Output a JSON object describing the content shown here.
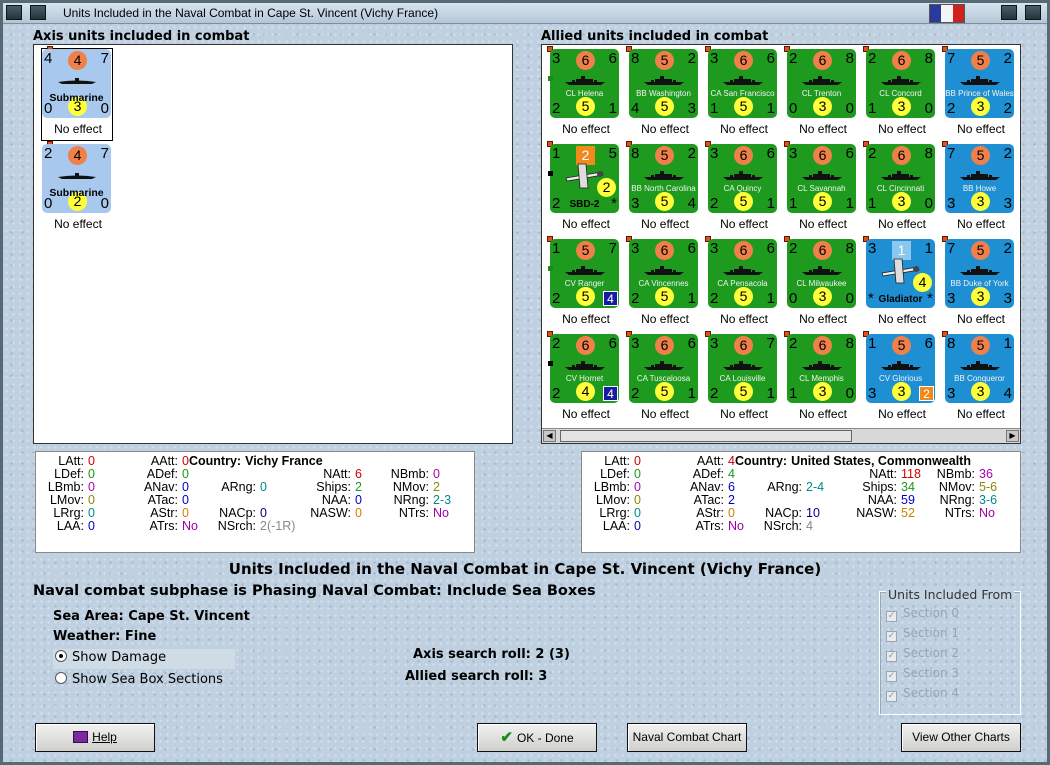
{
  "window": {
    "title": "Units Included in the Naval Combat in Cape St. Vincent (Vichy France)"
  },
  "axis_panel": {
    "title": "Axis units included in combat",
    "units": [
      {
        "name": "Submarine",
        "type": "submarine",
        "bg": "#a8c8ee",
        "tl": "4",
        "tc": "4",
        "tr": "7",
        "bl": "0",
        "bc": "3",
        "br": "0",
        "effect": "No effect",
        "selected": true
      },
      {
        "name": "Submarine",
        "type": "submarine",
        "bg": "#a8c8ee",
        "tl": "2",
        "tc": "4",
        "tr": "7",
        "bl": "0",
        "bc": "2",
        "br": "0",
        "effect": "No effect",
        "selected": false
      }
    ]
  },
  "allied_panel": {
    "title": "Allied units included in combat",
    "units": [
      {
        "name": "CL Helena",
        "type": "ship",
        "bg": "#1e9a1e",
        "tl": "3",
        "tc": "6",
        "tr": "6",
        "bl": "2",
        "bc": "5",
        "br": "1",
        "effect": "No effect"
      },
      {
        "name": "BB Washington",
        "type": "ship",
        "bg": "#1e9a1e",
        "tl": "8",
        "tc": "5",
        "tr": "2",
        "bl": "4",
        "bc": "5",
        "br": "3",
        "effect": "No effect"
      },
      {
        "name": "CA San Francisco",
        "type": "ship",
        "bg": "#1e9a1e",
        "tl": "3",
        "tc": "6",
        "tr": "6",
        "bl": "1",
        "bc": "5",
        "br": "1",
        "effect": "No effect"
      },
      {
        "name": "CL Trenton",
        "type": "ship",
        "bg": "#1e9a1e",
        "tl": "2",
        "tc": "6",
        "tr": "8",
        "bl": "0",
        "bc": "3",
        "br": "0",
        "effect": "No effect"
      },
      {
        "name": "CL Concord",
        "type": "ship",
        "bg": "#1e9a1e",
        "tl": "2",
        "tc": "6",
        "tr": "8",
        "bl": "1",
        "bc": "3",
        "br": "0",
        "effect": "No effect"
      },
      {
        "name": "BB Prince of Wales",
        "type": "ship",
        "bg": "#1e8fd2",
        "tl": "7",
        "tc": "5",
        "tr": "2",
        "bl": "2",
        "bc": "3",
        "br": "2",
        "effect": "No effect"
      },
      {
        "name": "SBD-2",
        "type": "plane",
        "bg": "#1e9a1e",
        "tl": "1",
        "tc": "2",
        "tr": "5",
        "bl": "2",
        "bc": "",
        "br": "*",
        "badge": "2",
        "badge_bg": "#ffff3a",
        "effect": "No effect"
      },
      {
        "name": "BB North Carolina",
        "type": "ship",
        "bg": "#1e9a1e",
        "tl": "8",
        "tc": "5",
        "tr": "2",
        "bl": "3",
        "bc": "5",
        "br": "4",
        "effect": "No effect"
      },
      {
        "name": "CA Quincy",
        "type": "ship",
        "bg": "#1e9a1e",
        "tl": "3",
        "tc": "6",
        "tr": "6",
        "bl": "2",
        "bc": "5",
        "br": "1",
        "effect": "No effect"
      },
      {
        "name": "CL Savannah",
        "type": "ship",
        "bg": "#1e9a1e",
        "tl": "3",
        "tc": "6",
        "tr": "6",
        "bl": "1",
        "bc": "5",
        "br": "1",
        "effect": "No effect"
      },
      {
        "name": "CL Cincinnati",
        "type": "ship",
        "bg": "#1e9a1e",
        "tl": "2",
        "tc": "6",
        "tr": "8",
        "bl": "1",
        "bc": "3",
        "br": "0",
        "effect": "No effect"
      },
      {
        "name": "BB Howe",
        "type": "ship",
        "bg": "#1e8fd2",
        "tl": "7",
        "tc": "5",
        "tr": "2",
        "bl": "3",
        "bc": "3",
        "br": "3",
        "effect": "No effect"
      },
      {
        "name": "CV Ranger",
        "type": "ship",
        "bg": "#1e9a1e",
        "tl": "1",
        "tc": "5",
        "tr": "7",
        "bl": "2",
        "bc": "5",
        "br": "",
        "badge": "4",
        "badge_bg": "#1a1aa0",
        "effect": "No effect"
      },
      {
        "name": "CA Vincennes",
        "type": "ship",
        "bg": "#1e9a1e",
        "tl": "3",
        "tc": "6",
        "tr": "6",
        "bl": "2",
        "bc": "5",
        "br": "1",
        "effect": "No effect"
      },
      {
        "name": "CA Pensacola",
        "type": "ship",
        "bg": "#1e9a1e",
        "tl": "3",
        "tc": "6",
        "tr": "6",
        "bl": "2",
        "bc": "5",
        "br": "1",
        "effect": "No effect"
      },
      {
        "name": "CL Milwaukee",
        "type": "ship",
        "bg": "#1e9a1e",
        "tl": "2",
        "tc": "6",
        "tr": "8",
        "bl": "0",
        "bc": "3",
        "br": "0",
        "effect": "No effect"
      },
      {
        "name": "Gladiator",
        "type": "plane",
        "bg": "#1e8fd2",
        "tl": "3",
        "tc": "1",
        "tr": "1",
        "bl": "*",
        "bc": "",
        "br": "*",
        "badge": "4",
        "badge_bg": "#ffff3a",
        "effect": "No effect"
      },
      {
        "name": "BB Duke of York",
        "type": "ship",
        "bg": "#1e8fd2",
        "tl": "7",
        "tc": "5",
        "tr": "2",
        "bl": "3",
        "bc": "3",
        "br": "3",
        "effect": "No effect"
      },
      {
        "name": "CV Hornet",
        "type": "ship",
        "bg": "#1e9a1e",
        "tl": "2",
        "tc": "6",
        "tr": "6",
        "bl": "2",
        "bc": "4",
        "br": "",
        "badge": "4",
        "badge_bg": "#1a1aa0",
        "effect": "No effect"
      },
      {
        "name": "CA Tuscaloosa",
        "type": "ship",
        "bg": "#1e9a1e",
        "tl": "3",
        "tc": "6",
        "tr": "6",
        "bl": "2",
        "bc": "5",
        "br": "1",
        "effect": "No effect"
      },
      {
        "name": "CA Louisville",
        "type": "ship",
        "bg": "#1e9a1e",
        "tl": "3",
        "tc": "6",
        "tr": "7",
        "bl": "2",
        "bc": "5",
        "br": "1",
        "effect": "No effect"
      },
      {
        "name": "CL Memphis",
        "type": "ship",
        "bg": "#1e9a1e",
        "tl": "2",
        "tc": "6",
        "tr": "8",
        "bl": "1",
        "bc": "3",
        "br": "0",
        "effect": "No effect"
      },
      {
        "name": "CV Glorious",
        "type": "ship",
        "bg": "#1e8fd2",
        "tl": "1",
        "tc": "5",
        "tr": "6",
        "bl": "3",
        "bc": "3",
        "br": "",
        "badge": "2",
        "badge_bg": "#f08a1c",
        "effect": "No effect"
      },
      {
        "name": "BB Conqueror",
        "type": "ship",
        "bg": "#1e8fd2",
        "tl": "8",
        "tc": "5",
        "tr": "1",
        "bl": "3",
        "bc": "3",
        "br": "4",
        "effect": "No effect"
      }
    ]
  },
  "axis_stats": {
    "country_label": "Country:",
    "country": "Vichy France",
    "rows": [
      {
        "k": "LAtt:",
        "v": "0",
        "c": "#d00000"
      },
      {
        "k": "LDef:",
        "v": "0",
        "c": "#1a9a1a"
      },
      {
        "k": "LBmb:",
        "v": "0",
        "c": "#b000b0"
      },
      {
        "k": "LMov:",
        "v": "0",
        "c": "#8a8a00"
      },
      {
        "k": "LRrg:",
        "v": "0",
        "c": "#008a8a"
      },
      {
        "k": "LAA:",
        "v": "0",
        "c": "#0000c0"
      },
      {
        "k": "AAtt:",
        "v": "0",
        "c": "#d00000"
      },
      {
        "k": "ADef:",
        "v": "0",
        "c": "#1a9a1a"
      },
      {
        "k": "ANav:",
        "v": "0",
        "c": "#0000c0"
      },
      {
        "k": "ATac:",
        "v": "0",
        "c": "#0000c0"
      },
      {
        "k": "AStr:",
        "v": "0",
        "c": "#d08000"
      },
      {
        "k": "ATrs:",
        "v": "No",
        "c": "#a000a0"
      },
      {
        "k": "ARng:",
        "v": "0",
        "c": "#008a8a"
      },
      {
        "k": "NACp:",
        "v": "0",
        "c": "#000080"
      },
      {
        "k": "NAtt:",
        "v": "6",
        "c": "#d00000"
      },
      {
        "k": "Ships:",
        "v": "2",
        "c": "#1a9a1a"
      },
      {
        "k": "NAA:",
        "v": "0",
        "c": "#0000c0"
      },
      {
        "k": "NASW:",
        "v": "0",
        "c": "#d08000"
      },
      {
        "k": "NSrch:",
        "v": "2(-1R)",
        "c": "#888888"
      },
      {
        "k": "NBmb:",
        "v": "0",
        "c": "#b000b0"
      },
      {
        "k": "NMov:",
        "v": "2",
        "c": "#8a8a00"
      },
      {
        "k": "NRng:",
        "v": "2-3",
        "c": "#008a8a"
      },
      {
        "k": "NTrs:",
        "v": "No",
        "c": "#a000a0"
      }
    ]
  },
  "allied_stats": {
    "country_label": "Country:",
    "country": "United States, Commonwealth",
    "rows": [
      {
        "k": "LAtt:",
        "v": "0",
        "c": "#d00000"
      },
      {
        "k": "LDef:",
        "v": "0",
        "c": "#1a9a1a"
      },
      {
        "k": "LBmb:",
        "v": "0",
        "c": "#b000b0"
      },
      {
        "k": "LMov:",
        "v": "0",
        "c": "#8a8a00"
      },
      {
        "k": "LRrg:",
        "v": "0",
        "c": "#008a8a"
      },
      {
        "k": "LAA:",
        "v": "0",
        "c": "#0000c0"
      },
      {
        "k": "AAtt:",
        "v": "4",
        "c": "#d00000"
      },
      {
        "k": "ADef:",
        "v": "4",
        "c": "#1a9a1a"
      },
      {
        "k": "ANav:",
        "v": "6",
        "c": "#0000c0"
      },
      {
        "k": "ATac:",
        "v": "2",
        "c": "#0000c0"
      },
      {
        "k": "AStr:",
        "v": "0",
        "c": "#d08000"
      },
      {
        "k": "ATrs:",
        "v": "No",
        "c": "#a000a0"
      },
      {
        "k": "ARng:",
        "v": "2-4",
        "c": "#008a8a"
      },
      {
        "k": "NACp:",
        "v": "10",
        "c": "#000080"
      },
      {
        "k": "NAtt:",
        "v": "118",
        "c": "#d00000"
      },
      {
        "k": "Ships:",
        "v": "34",
        "c": "#1a9a1a"
      },
      {
        "k": "NAA:",
        "v": "59",
        "c": "#0000c0"
      },
      {
        "k": "NASW:",
        "v": "52",
        "c": "#d08000"
      },
      {
        "k": "NSrch:",
        "v": "4",
        "c": "#888888"
      },
      {
        "k": "NBmb:",
        "v": "36",
        "c": "#b000b0"
      },
      {
        "k": "NMov:",
        "v": "5-6",
        "c": "#8a8a00"
      },
      {
        "k": "NRng:",
        "v": "3-6",
        "c": "#008a8a"
      },
      {
        "k": "NTrs:",
        "v": "No",
        "c": "#a000a0"
      }
    ]
  },
  "info": {
    "heading": "Units Included in the Naval Combat in Cape St. Vincent (Vichy France)",
    "subphase": "Naval combat subphase is Phasing Naval Combat: Include Sea Boxes",
    "sea_area_label": "Sea Area:",
    "sea_area": "Cape St. Vincent",
    "weather_label": "Weather:",
    "weather": "Fine",
    "show_damage": "Show Damage",
    "show_sections": "Show Sea Box Sections",
    "axis_search_label": "Axis search roll:",
    "axis_search": "2 (3)",
    "allied_search_label": "Allied search roll:",
    "allied_search": "3"
  },
  "sections_group": {
    "title": "Units Included From",
    "items": [
      "Section 0",
      "Section 1",
      "Section 2",
      "Section 3",
      "Section 4"
    ]
  },
  "buttons": {
    "help": "Help",
    "ok": "OK - Done",
    "naval_chart": "Naval Combat Chart",
    "other_charts": "View Other Charts"
  },
  "flag_colors": [
    "#2a3a9a",
    "#f4f4f4",
    "#d02020"
  ]
}
